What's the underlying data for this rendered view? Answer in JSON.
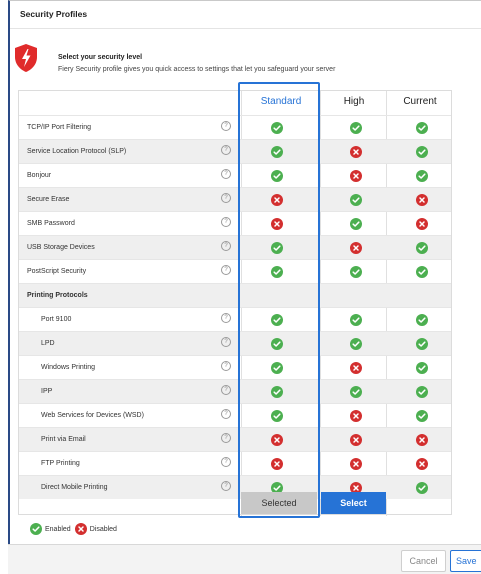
{
  "dialog": {
    "title": "Security Profiles"
  },
  "intro": {
    "heading": "Select your security level",
    "description": "Fiery Security profile gives you quick access to settings that let you safeguard your server"
  },
  "columns": {
    "standard": "Standard",
    "high": "High",
    "current": "Current"
  },
  "rows": [
    {
      "label": "TCP/IP Port Filtering",
      "help": "?",
      "standard": "enabled",
      "high": "enabled",
      "current": "enabled"
    },
    {
      "label": "Service Location Protocol (SLP)",
      "help": "?",
      "standard": "enabled",
      "high": "disabled",
      "current": "enabled"
    },
    {
      "label": "Bonjour",
      "help": "?",
      "standard": "enabled",
      "high": "disabled",
      "current": "enabled"
    },
    {
      "label": "Secure Erase",
      "help": "?",
      "standard": "disabled",
      "high": "enabled",
      "current": "disabled"
    },
    {
      "label": "SMB Password",
      "help": "?",
      "standard": "disabled",
      "high": "enabled",
      "current": "disabled"
    },
    {
      "label": "USB Storage Devices",
      "help": "?",
      "standard": "enabled",
      "high": "disabled",
      "current": "enabled"
    },
    {
      "label": "PostScript Security",
      "help": "?",
      "standard": "enabled",
      "high": "enabled",
      "current": "enabled"
    },
    {
      "label": "Printing Protocols",
      "group": true
    },
    {
      "label": "Port 9100",
      "help": "?",
      "indent": true,
      "standard": "enabled",
      "high": "enabled",
      "current": "enabled"
    },
    {
      "label": "LPD",
      "help": "?",
      "indent": true,
      "standard": "enabled",
      "high": "enabled",
      "current": "enabled"
    },
    {
      "label": "Windows Printing",
      "help": "?",
      "indent": true,
      "standard": "enabled",
      "high": "disabled",
      "current": "enabled"
    },
    {
      "label": "IPP",
      "help": "?",
      "indent": true,
      "standard": "enabled",
      "high": "enabled",
      "current": "enabled"
    },
    {
      "label": "Web Services for Devices (WSD)",
      "help": "?",
      "indent": true,
      "standard": "enabled",
      "high": "disabled",
      "current": "enabled"
    },
    {
      "label": "Print via Email",
      "help": "?",
      "indent": true,
      "standard": "disabled",
      "high": "disabled",
      "current": "disabled"
    },
    {
      "label": "FTP Printing",
      "help": "?",
      "indent": true,
      "standard": "disabled",
      "high": "disabled",
      "current": "disabled"
    },
    {
      "label": "Direct Mobile Printing",
      "help": "?",
      "indent": true,
      "standard": "enabled",
      "high": "disabled",
      "current": "enabled"
    }
  ],
  "actions": {
    "standard_button": "Selected",
    "high_button": "Select"
  },
  "legend": {
    "enabled": "Enabled",
    "disabled": "Disabled"
  },
  "footer": {
    "cancel": "Cancel",
    "save": "Save"
  },
  "colors": {
    "accent": "#2673d6",
    "enabled": "#4caf50",
    "disabled": "#d32f2f",
    "brand_red": "#e02b2b"
  },
  "icons": {
    "enabled": "check-circle-icon",
    "disabled": "x-circle-icon",
    "help": "help-circle-icon",
    "brand": "fiery-shield-icon"
  }
}
